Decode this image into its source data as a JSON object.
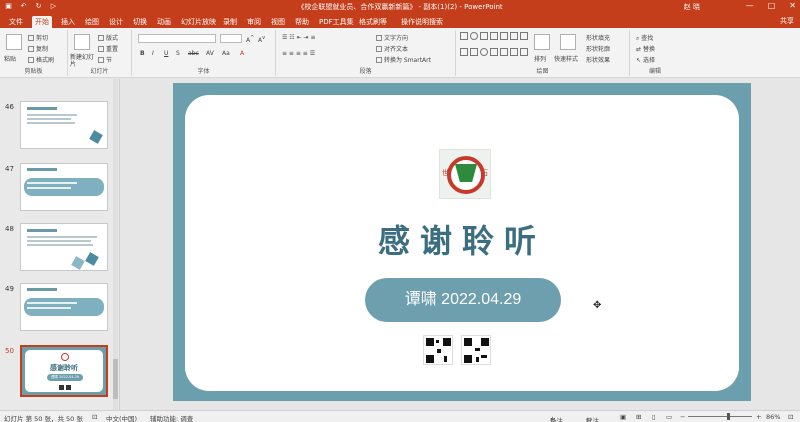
{
  "titlebar": {
    "title": "《校企联盟就业员、合作双赢新新篇》 - 副本(1)(2) - PowerPoint",
    "user": "赵 晓",
    "min": "—",
    "restore": "□",
    "close": "✕"
  },
  "tabs": [
    "文件",
    "开始",
    "插入",
    "绘图",
    "设计",
    "切换",
    "动画",
    "幻灯片放映",
    "录制",
    "审阅",
    "视图",
    "帮助",
    "PDF工具集",
    "格式刷等",
    "操作说明搜索"
  ],
  "share_label": "共享",
  "ribbon": {
    "clipboard": {
      "label": "剪贴板",
      "paste": "粘贴",
      "cut": "剪切",
      "copy": "复制",
      "format_painter": "格式刷"
    },
    "slides": {
      "label": "幻灯片",
      "new_slide": "新建幻灯片",
      "layout": "版式",
      "reset": "重置",
      "section": "节"
    },
    "font": {
      "label": "字体",
      "buttons": [
        "B",
        "I",
        "U",
        "S",
        "abc",
        "AV",
        "Aa",
        "A"
      ]
    },
    "paragraph": {
      "label": "段落",
      "text_direction": "文字方向",
      "align_text": "对齐文本",
      "smartart": "转换为 SmartArt"
    },
    "drawing": {
      "label": "绘图",
      "arrange": "排列",
      "quick_styles": "快速样式",
      "shape_fill": "形状填充",
      "shape_outline": "形状轮廓",
      "shape_effects": "形状效果"
    },
    "editing": {
      "label": "编辑",
      "find": "查找",
      "replace": "替换",
      "select": "选择"
    }
  },
  "thumbnails": [
    {
      "num": "46"
    },
    {
      "num": "47"
    },
    {
      "num": "48"
    },
    {
      "num": "49"
    },
    {
      "num": "50",
      "active": true,
      "title": "感谢聆听",
      "pill": "谭啸 2022.04.29"
    }
  ],
  "slide": {
    "logo_left": "世",
    "logo_right": "石",
    "title": "感谢聆听",
    "pill_text": "谭啸 2022.04.29"
  },
  "statusbar": {
    "slide_info": "幻灯片 第 50 张，共 50 张",
    "language": "中文(中国)",
    "accessibility": "辅助功能: 调查",
    "notes": "备注",
    "comments": "批注",
    "zoom": "86%"
  },
  "colors": {
    "accent": "#c43e1c",
    "slide_frame": "#6c9fad",
    "title_text": "#3a6e80"
  }
}
